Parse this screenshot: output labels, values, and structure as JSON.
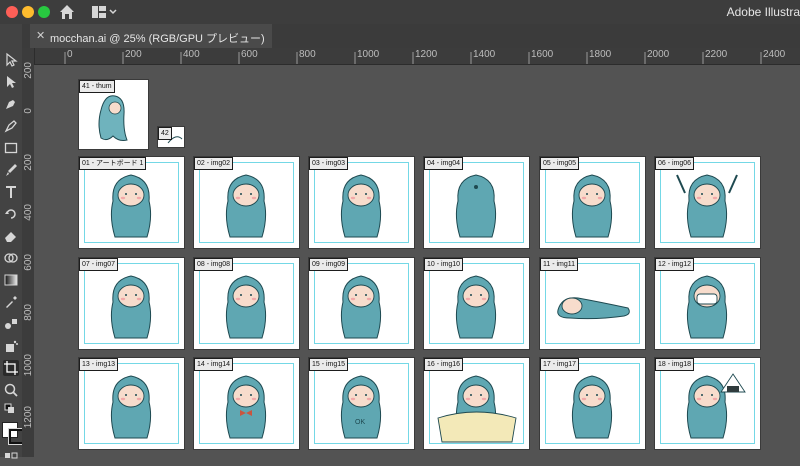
{
  "app": {
    "title": "Adobe Illustra"
  },
  "document_tab": {
    "title": "mocchan.ai @ 25% (RGB/GPU プレビュー)"
  },
  "ruler": {
    "h_labels": [
      "200",
      "0",
      "200",
      "400",
      "600",
      "800",
      "1000",
      "1200",
      "1400",
      "1600",
      "1800",
      "2000",
      "2200",
      "2400"
    ],
    "v_labels": [
      "200",
      "0",
      "200",
      "400",
      "600",
      "800",
      "1000",
      "1200"
    ]
  },
  "colors": {
    "accent": "#74d8e6",
    "character": "#5fa7b2",
    "face": "#f7dccc"
  },
  "artboards": [
    {
      "label": "41 - thum"
    },
    {
      "label": "42"
    },
    {
      "label": "01 - アートボード 1"
    },
    {
      "label": "02 - img02"
    },
    {
      "label": "03 - img03"
    },
    {
      "label": "04 - img04"
    },
    {
      "label": "05 - img05"
    },
    {
      "label": "06 - img06"
    },
    {
      "label": "07 - img07"
    },
    {
      "label": "08 - img08"
    },
    {
      "label": "09 - img09"
    },
    {
      "label": "10 - img10"
    },
    {
      "label": "11 - img11"
    },
    {
      "label": "12 - img12"
    },
    {
      "label": "13 - img13"
    },
    {
      "label": "14 - img14"
    },
    {
      "label": "15 - img15"
    },
    {
      "label": "16 - img16"
    },
    {
      "label": "17 - img17"
    },
    {
      "label": "18 - img18"
    }
  ]
}
